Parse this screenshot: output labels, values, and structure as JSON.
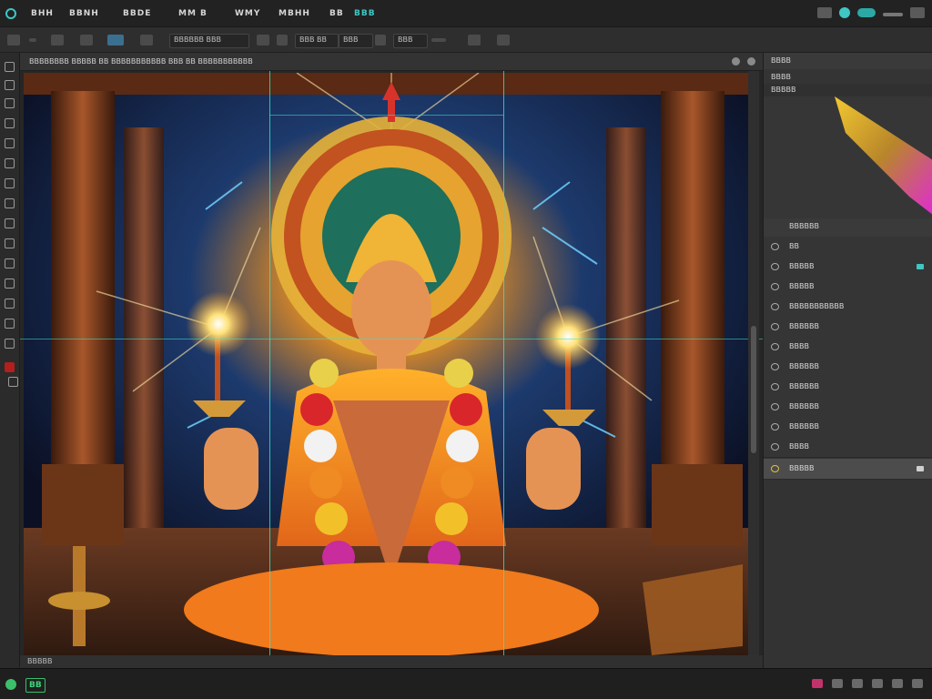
{
  "menubar": {
    "items": [
      {
        "label": "BHH"
      },
      {
        "label": "BBNH"
      },
      {
        "label": "BBDE"
      },
      {
        "label": "MM B"
      },
      {
        "label": "WMY"
      },
      {
        "label": "MBHH"
      },
      {
        "label": "BB"
      },
      {
        "label": "BBB"
      }
    ]
  },
  "options": {
    "field1": "BBBBBB BBB",
    "field2": "BBB BB",
    "field3": "BBB",
    "field4": "BBB"
  },
  "document": {
    "tab_title": "BBBBBBBB BBBBB BB BBBBBBBBBBB BBB BB BBBBBBBBBBB",
    "status": "BBBBB"
  },
  "panels": {
    "top_header": "BBBB",
    "sub1": "BBBB",
    "sub2": "BBBBB",
    "layers_header": "BBBBBB"
  },
  "layers": [
    {
      "name": "BB"
    },
    {
      "name": "BBBBB"
    },
    {
      "name": "BBBBB"
    },
    {
      "name": "BBBBBBBBBBB"
    },
    {
      "name": "BBBBBB"
    },
    {
      "name": "BBBB"
    },
    {
      "name": "BBBBBB"
    },
    {
      "name": "BBBBBB"
    },
    {
      "name": "BBBBBB"
    },
    {
      "name": "BBBBBB"
    },
    {
      "name": "BBBB"
    },
    {
      "name": "BBBBB"
    }
  ],
  "statusbar": {
    "zoom": "BB"
  },
  "colors": {
    "accent": "#3ec7c4",
    "guide": "#35e6c9",
    "panel_bg": "#333333",
    "app_bg": "#2b2b2b"
  }
}
